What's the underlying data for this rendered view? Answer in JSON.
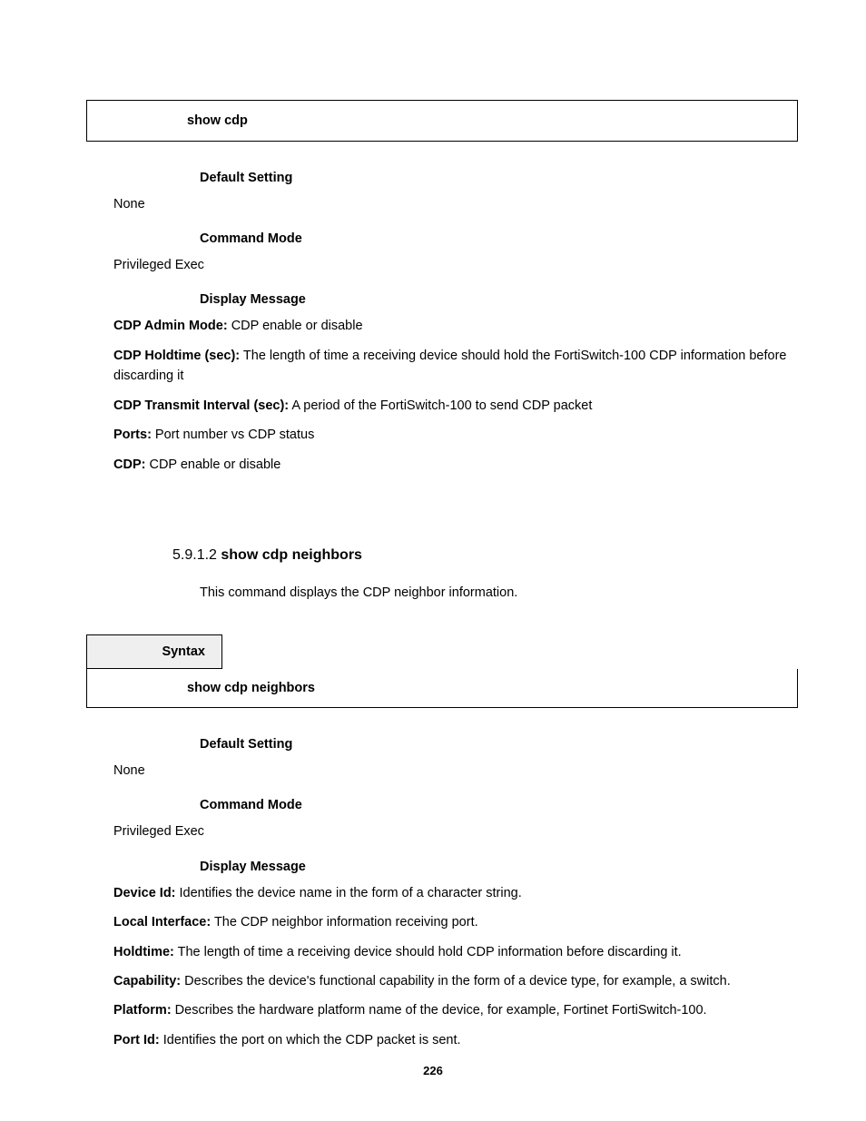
{
  "section1": {
    "command": "show cdp",
    "default_setting_heading": "Default Setting",
    "default_setting_value": "None",
    "command_mode_heading": "Command Mode",
    "command_mode_value": "Privileged Exec",
    "display_message_heading": "Display Message",
    "fields": [
      {
        "label": "CDP Admin Mode:",
        "text": " CDP enable or disable"
      },
      {
        "label": "CDP Holdtime (sec):",
        "text": " The length of time a receiving device should hold the FortiSwitch-100 CDP information before discarding it"
      },
      {
        "label": "CDP Transmit Interval (sec):",
        "text": " A period of the FortiSwitch-100 to send CDP packet"
      },
      {
        "label": "Ports:",
        "text": " Port number vs CDP status"
      },
      {
        "label": "CDP:",
        "text": " CDP enable or disable"
      }
    ]
  },
  "section2": {
    "number": "5.9.1.2 ",
    "title": "show cdp neighbors",
    "intro": "This command displays the CDP neighbor information.",
    "syntax_label": "Syntax",
    "command": "show cdp neighbors",
    "default_setting_heading": "Default Setting",
    "default_setting_value": "None",
    "command_mode_heading": "Command Mode",
    "command_mode_value": "Privileged Exec",
    "display_message_heading": "Display Message",
    "fields": [
      {
        "label": "Device Id:",
        "text": " Identifies the device name in the form of a character string."
      },
      {
        "label": "Local Interface:",
        "text": " The CDP neighbor information receiving port."
      },
      {
        "label": "Holdtime:",
        "text": " The length of time a receiving device should hold CDP information before discarding it."
      },
      {
        "label": "Capability:",
        "text": " Describes the device's functional capability in the form of a device type, for example, a switch."
      },
      {
        "label": "Platform:",
        "text": " Describes the hardware platform name of the device, for example, Fortinet FortiSwitch-100."
      },
      {
        "label": "Port Id:",
        "text": " Identifies the port on which the CDP packet is sent."
      }
    ]
  },
  "page_number": "226"
}
